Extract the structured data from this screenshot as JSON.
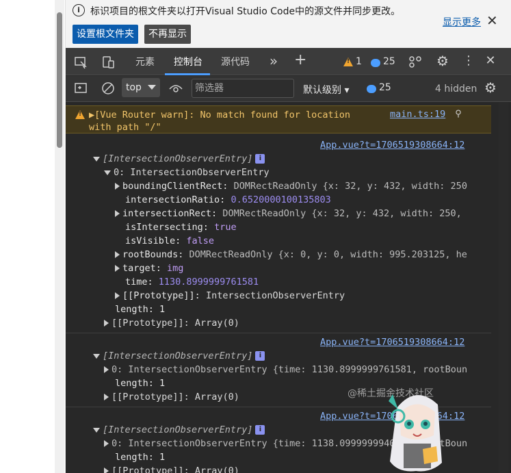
{
  "banner": {
    "message": "标识项目的根文件夹以打开Visual Studio Code中的源文件并同步更改。",
    "primary_button": "设置根文件夹",
    "secondary_button": "不再显示",
    "more_link": "显示更多"
  },
  "toolbar": {
    "tabs": [
      "元素",
      "控制台",
      "源代码"
    ],
    "active_tab": "控制台",
    "warning_count": "1",
    "message_count": "25"
  },
  "filterbar": {
    "context": "top",
    "filter_placeholder": "筛选器",
    "level": "默认级别",
    "message_count": "25",
    "hidden": "4 hidden"
  },
  "console": {
    "warning": {
      "line1": "▶[Vue Router warn]: No match found for location",
      "line2": "with path \"/\"",
      "source": "main.ts:19"
    },
    "entries": [
      {
        "source": "App.vue?t=1706519308664:12",
        "header": "[IntersectionObserverEntry]",
        "item0_label": "0: IntersectionObserverEntry",
        "props": [
          {
            "key": "boundingClientRect:",
            "value": "DOMRectReadOnly {x: 32, y: 432, width: 250"
          },
          {
            "key": "intersectionRatio:",
            "value": "0.6520000100135803"
          },
          {
            "key": "intersectionRect:",
            "value": "DOMRectReadOnly {x: 32, y: 432, width: 250,"
          },
          {
            "key": "isIntersecting:",
            "value": "true"
          },
          {
            "key": "isVisible:",
            "value": "false"
          },
          {
            "key": "rootBounds:",
            "value": "DOMRectReadOnly {x: 0, y: 0, width: 995.203125, he"
          },
          {
            "key": "target:",
            "value": "img"
          },
          {
            "key": "time:",
            "value": "1130.8999999761581"
          },
          {
            "key": "[[Prototype]]:",
            "value": "IntersectionObserverEntry"
          }
        ],
        "length": "length: 1",
        "proto": "[[Prototype]]: Array(0)"
      },
      {
        "source": "App.vue?t=1706519308664:12",
        "header": "[IntersectionObserverEntry]",
        "item0": "0: IntersectionObserverEntry {time: 1130.8999999761581, rootBoun",
        "length": "length: 1",
        "proto": "[[Prototype]]: Array(0)"
      },
      {
        "source": "App.vue?t=1706519308664:12",
        "header": "[IntersectionObserverEntry]",
        "item0": "0: IntersectionObserverEntry {time: 1138.0999999940395, rootBoun",
        "length": "length: 1",
        "proto": "[[Prototype]]: Array(0)"
      }
    ]
  },
  "watermark": "@稀土掘金技术社区"
}
